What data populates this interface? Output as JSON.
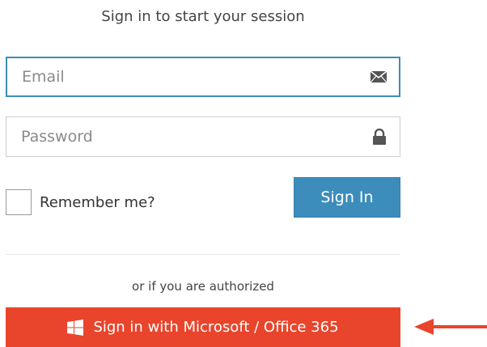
{
  "header": {
    "title": "Sign in to start your session"
  },
  "form": {
    "email": {
      "placeholder": "Email",
      "value": "",
      "icon": "envelope-icon"
    },
    "password": {
      "placeholder": "Password",
      "value": "",
      "icon": "lock-icon"
    },
    "remember_label": "Remember me?",
    "remember_checked": false,
    "signin_label": "Sign In"
  },
  "alt_login": {
    "or_text": "or if you are authorized",
    "microsoft_label": "Sign in with Microsoft / Office 365",
    "icon": "windows-icon"
  },
  "colors": {
    "primary": "#3c8dbc",
    "microsoft": "#e8452c",
    "arrow": "#e8452c"
  }
}
